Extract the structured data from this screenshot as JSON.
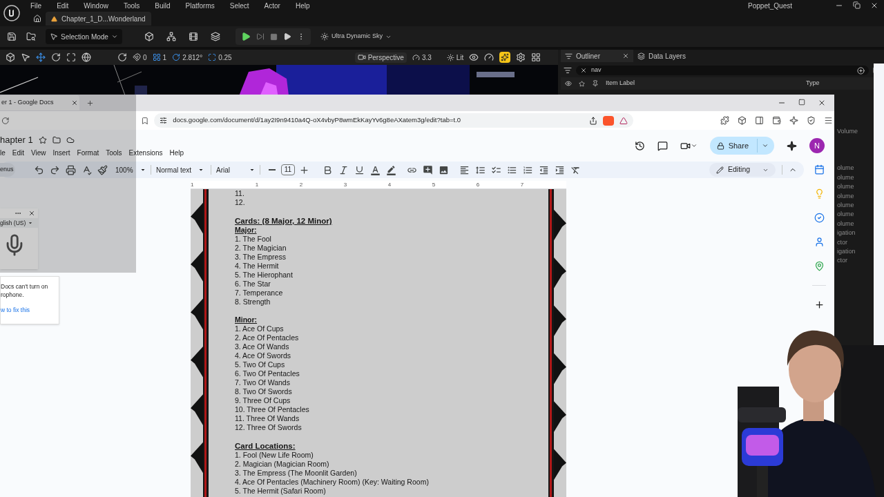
{
  "editor": {
    "menu": [
      "File",
      "Edit",
      "Window",
      "Tools",
      "Build",
      "Platforms",
      "Select",
      "Actor",
      "Help"
    ],
    "level_tab": "Chapter_1_D...Wonderland",
    "project": "Poppet_Quest",
    "toolbar": {
      "mode": "Selection Mode",
      "sky": "Ultra Dynamic Sky"
    },
    "viewport_toolbar": {
      "rotation_snap": "0",
      "scale_steps": "1",
      "angle": "2.812°",
      "grid": "0.25",
      "view": "Perspective",
      "speed": "3.3",
      "lighting": "Lit"
    },
    "outliner": {
      "tabs": [
        {
          "label": "Outliner",
          "selected": true
        },
        {
          "label": "Data Layers",
          "selected": false
        }
      ],
      "search": "nav",
      "columns": [
        "Item Label",
        "Type"
      ],
      "peek_rows": [
        "Volume",
        "olume",
        "olume",
        "olume",
        "olume",
        "olume",
        "olume",
        "olume",
        "igation",
        "ctor",
        "igation",
        "ctor"
      ]
    }
  },
  "browser": {
    "tab": "er 1 - Google Docs",
    "url": "docs.google.com/document/d/1ay2I9n9410a4Q-oX4vbyP8wmEkKayYv6g8eAXatem3g/edit?tab=t.0"
  },
  "docs": {
    "title": "hapter 1",
    "menu": [
      "le",
      "Edit",
      "View",
      "Insert",
      "Format",
      "Tools",
      "Extensions",
      "Help"
    ],
    "toolbar": {
      "menus": "enus",
      "zoom": "100%",
      "style": "Normal text",
      "font": "Arial",
      "size": "11"
    },
    "mode": "Editing",
    "share": "Share",
    "avatar": "N",
    "ruler": [
      "1",
      "1",
      "2",
      "3",
      "4",
      "5",
      "6",
      "7"
    ],
    "lines": [
      {
        "kind": "item",
        "text": "11."
      },
      {
        "kind": "item",
        "text": "12."
      },
      {
        "kind": "space"
      },
      {
        "kind": "heading",
        "text": "Cards: (8 Major, 12 Minor)"
      },
      {
        "kind": "subheading",
        "text": "Major:"
      },
      {
        "kind": "item",
        "text": "1. The Fool"
      },
      {
        "kind": "item",
        "text": "2. The Magician"
      },
      {
        "kind": "item",
        "text": "3. The Empress"
      },
      {
        "kind": "item",
        "text": "4. The Hermit"
      },
      {
        "kind": "item",
        "text": "5. The Hierophant"
      },
      {
        "kind": "item",
        "text": "6. The Star"
      },
      {
        "kind": "item",
        "text": "7. Temperance"
      },
      {
        "kind": "item",
        "text": "8. Strength"
      },
      {
        "kind": "space"
      },
      {
        "kind": "subheading",
        "text": "Minor:"
      },
      {
        "kind": "item",
        "text": "1. Ace Of Cups"
      },
      {
        "kind": "item",
        "text": "2. Ace Of Pentacles"
      },
      {
        "kind": "item",
        "text": "3. Ace Of Wands"
      },
      {
        "kind": "item",
        "text": "4. Ace Of Swords"
      },
      {
        "kind": "item",
        "text": "5. Two Of Cups"
      },
      {
        "kind": "item",
        "text": "6. Two Of Pentacles"
      },
      {
        "kind": "item",
        "text": "7. Two Of Wands"
      },
      {
        "kind": "item",
        "text": "8. Two Of Swords"
      },
      {
        "kind": "item",
        "text": "9. Three Of Cups"
      },
      {
        "kind": "item",
        "text": "10. Three Of Pentacles"
      },
      {
        "kind": "item",
        "text": "11. Three Of Wands"
      },
      {
        "kind": "item",
        "text": "12. Three Of Swords"
      },
      {
        "kind": "space"
      },
      {
        "kind": "heading",
        "text": "Card Locations:"
      },
      {
        "kind": "item",
        "text": "1. Fool (New Life Room)"
      },
      {
        "kind": "item",
        "text": "2. Magician (Magician Room)"
      },
      {
        "kind": "item",
        "text": "3. The Empress (The Moonlit Garden)"
      },
      {
        "kind": "item",
        "text": "4. Ace Of Pentacles (Machinery Room) (Key: Waiting Room)"
      },
      {
        "kind": "item",
        "text": "5. The Hermit (Safari Room)"
      }
    ]
  },
  "voice_typing": {
    "language": "glish (US)",
    "message": "Docs can't turn on rophone.",
    "link": "w to fix this"
  }
}
